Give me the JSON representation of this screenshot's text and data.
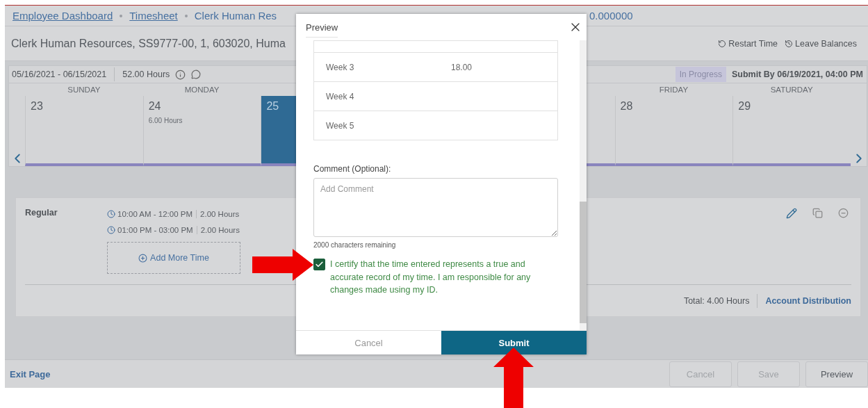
{
  "breadcrumbs": [
    {
      "label": "Employee Dashboard"
    },
    {
      "label": "Timesheet"
    },
    {
      "label": "Clerk Human Res"
    }
  ],
  "breadcrumb_tail": "0.000000",
  "page_title": "Clerk Human Resources, SS9777-00, 1, 603020, Huma",
  "header_actions": [
    {
      "label": "Restart Time",
      "kind": "restart"
    },
    {
      "label": "Leave Balances",
      "kind": "balances"
    }
  ],
  "period": {
    "range": "05/16/2021 - 06/15/2021",
    "hours": "52.00 Hours",
    "status": "In Progress",
    "deadline": "Submit By 06/19/2021, 04:00 PM"
  },
  "days": [
    {
      "header": "SUNDAY",
      "number": "23",
      "selected": false
    },
    {
      "header": "MONDAY",
      "number": "24",
      "hours": "6.00 Hours",
      "selected": false
    },
    {
      "number": "25",
      "selected": true
    },
    {
      "selected": false
    },
    {
      "header": "FRIDAY",
      "number": "28",
      "selected": false
    },
    {
      "header": "SATURDAY",
      "number": "29",
      "selected": false
    }
  ],
  "entry": {
    "type": "Regular",
    "times": [
      {
        "range": "10:00 AM - 12:00 PM",
        "hours": "2.00 Hours"
      },
      {
        "range": "01:00 PM - 03:00 PM",
        "hours": "2.00 Hours"
      }
    ],
    "add_button": "Add More Time",
    "total": "Total: 4.00 Hours",
    "link": "Account Distribution"
  },
  "footer": {
    "exit": "Exit Page",
    "buttons": [
      {
        "label": "Cancel",
        "disabled": true
      },
      {
        "label": "Save",
        "disabled": true
      },
      {
        "label": "Preview",
        "disabled": false
      }
    ]
  },
  "modal": {
    "title": "Preview",
    "weeks": [
      {
        "label": "Week 3",
        "hours": "18.00"
      },
      {
        "label": "Week 4"
      },
      {
        "label": "Week 5"
      }
    ],
    "comment_label": "Comment (Optional):",
    "comment_placeholder": "Add Comment",
    "remaining": "2000 characters remaining",
    "certify": {
      "checked": true,
      "text": "I certify that the time entered represents a true and accurate record of my time. I am responsible for any changes made using my ID."
    },
    "buttons": [
      {
        "label": "Cancel",
        "primary": false
      },
      {
        "label": "Submit",
        "primary": true
      }
    ]
  }
}
